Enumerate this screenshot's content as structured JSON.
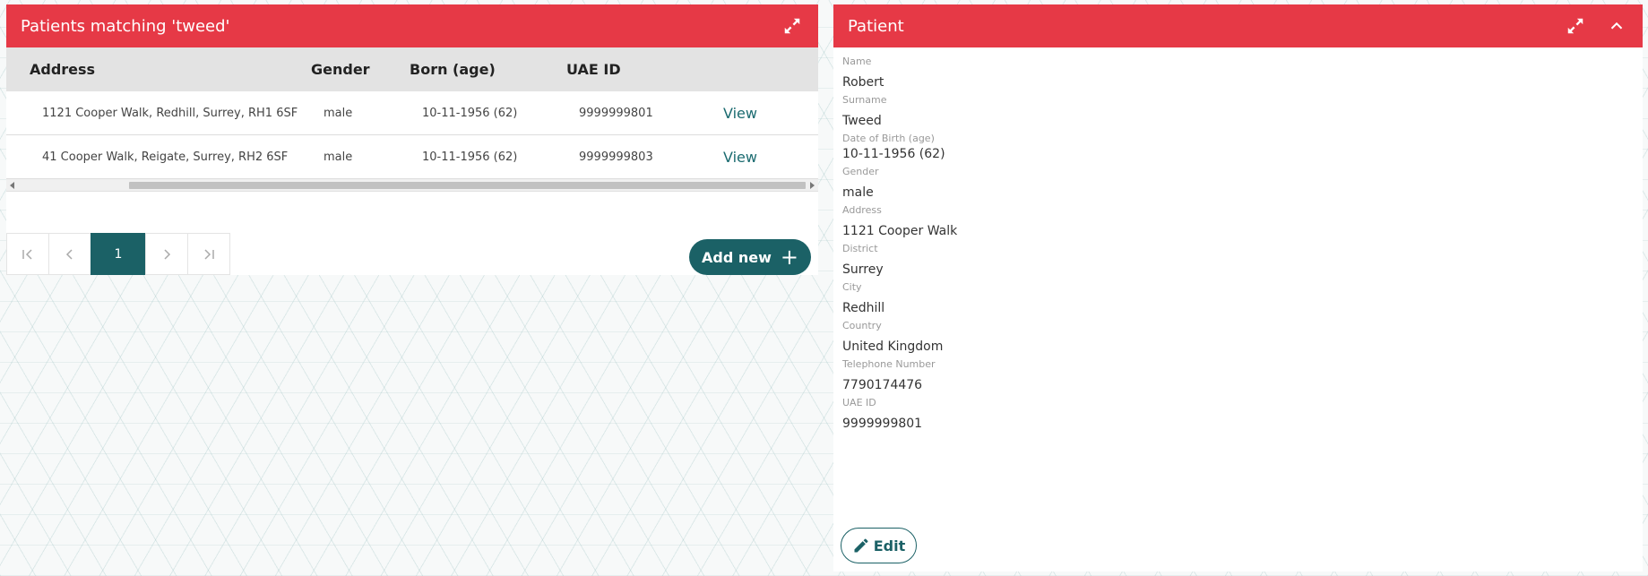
{
  "results_panel": {
    "title": "Patients matching 'tweed'",
    "columns": {
      "address": "Address",
      "gender": "Gender",
      "born": "Born (age)",
      "uae_id": "UAE ID"
    },
    "rows": [
      {
        "address": "1121 Cooper Walk, Redhill, Surrey, RH1 6SF",
        "gender": "male",
        "born": "10-11-1956 (62)",
        "uae_id": "9999999801",
        "action": "View"
      },
      {
        "address": "41 Cooper Walk, Reigate, Surrey, RH2 6SF",
        "gender": "male",
        "born": "10-11-1956 (62)",
        "uae_id": "9999999803",
        "action": "View"
      }
    ],
    "pagination": {
      "current_page": "1"
    },
    "add_new_label": "Add new",
    "icons": {
      "expand": "expand-icon"
    }
  },
  "patient_panel": {
    "title": "Patient",
    "fields": [
      {
        "label": "Name",
        "value": "Robert"
      },
      {
        "label": "Surname",
        "value": "Tweed"
      },
      {
        "label": "Date of Birth (age)",
        "value": "10-11-1956 (62)"
      },
      {
        "label": "Gender",
        "value": "male"
      },
      {
        "label": "Address",
        "value": "1121 Cooper Walk"
      },
      {
        "label": "District",
        "value": "Surrey"
      },
      {
        "label": "City",
        "value": "Redhill"
      },
      {
        "label": "Country",
        "value": "United Kingdom"
      },
      {
        "label": "Telephone Number",
        "value": "7790174476"
      },
      {
        "label": "UAE ID",
        "value": "9999999801"
      }
    ],
    "edit_label": "Edit",
    "icons": {
      "expand": "expand-icon",
      "collapse": "chevron-up-icon",
      "edit": "pencil-icon"
    }
  },
  "colors": {
    "header": "#e63946",
    "accent": "#1b6166",
    "link": "#1b6b70"
  }
}
